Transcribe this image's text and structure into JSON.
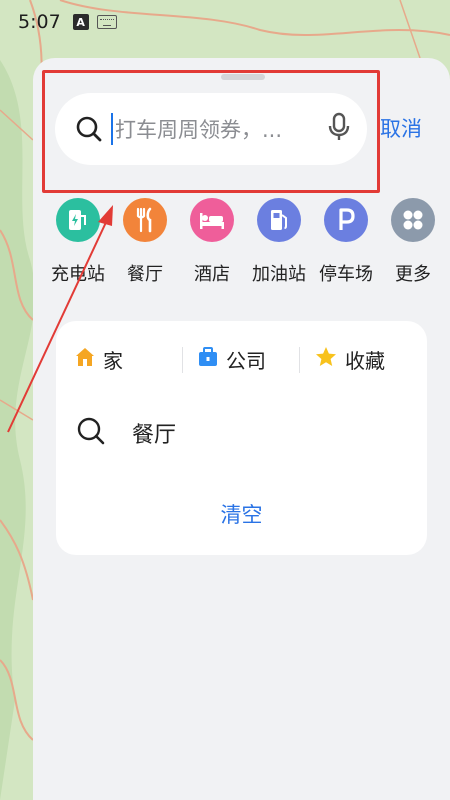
{
  "status_bar": {
    "time": "5:07",
    "indicator": "A"
  },
  "search": {
    "placeholder": "打车周周领券，...",
    "cancel_label": "取消"
  },
  "categories": [
    {
      "label": "充电站",
      "icon": "charging-station-icon",
      "color": "#2bbf9f"
    },
    {
      "label": "餐厅",
      "icon": "fork-knife-icon",
      "color": "#f2843a"
    },
    {
      "label": "酒店",
      "icon": "bed-icon",
      "color": "#ef5e9a"
    },
    {
      "label": "加油站",
      "icon": "gas-pump-icon",
      "color": "#6b7fe0"
    },
    {
      "label": "停车场",
      "icon": "parking-icon",
      "color": "#6b7fe0"
    },
    {
      "label": "更多",
      "icon": "grid-more-icon",
      "color": "#8c9aab"
    }
  ],
  "shortcuts": {
    "home": "家",
    "company": "公司",
    "favorites": "收藏"
  },
  "history": [
    {
      "text": "餐厅"
    }
  ],
  "clear_label": "清空",
  "colors": {
    "accent": "#2a73e5",
    "annotation": "#e23b36"
  }
}
